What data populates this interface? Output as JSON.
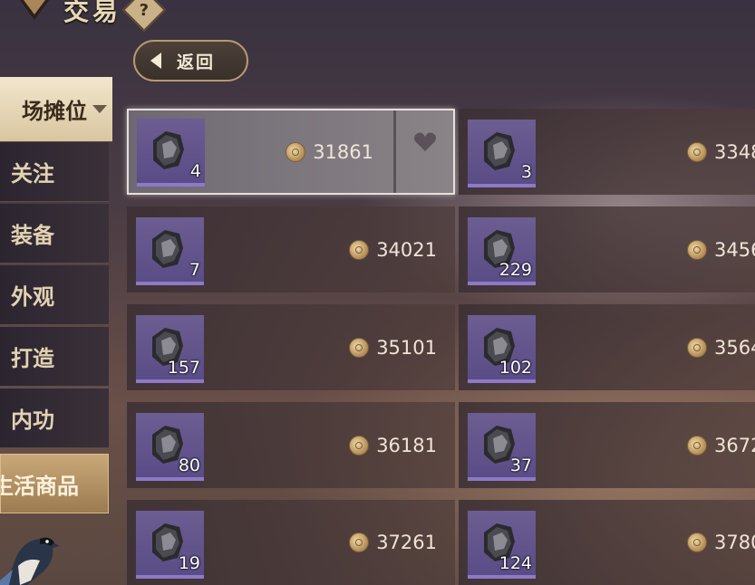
{
  "header": {
    "title": "交易",
    "help_icon": "question-diamond-icon"
  },
  "back_button": {
    "label": "返回",
    "icon": "caret-left-icon"
  },
  "sidebar": {
    "items": [
      {
        "label": "场摊位",
        "has_dropdown": true
      },
      {
        "label": "关注"
      },
      {
        "label": "装备"
      },
      {
        "label": "外观"
      },
      {
        "label": "打造"
      },
      {
        "label": "内功"
      },
      {
        "label": "生活商品"
      }
    ]
  },
  "listings": [
    {
      "qty": "4",
      "price": "31861",
      "favorite_icon": "heart-icon"
    },
    {
      "qty": "3",
      "price": "3348"
    },
    {
      "qty": "7",
      "price": "34021"
    },
    {
      "qty": "229",
      "price": "3456"
    },
    {
      "qty": "157",
      "price": "35101"
    },
    {
      "qty": "102",
      "price": "3564"
    },
    {
      "qty": "80",
      "price": "36181"
    },
    {
      "qty": "37",
      "price": "3672"
    },
    {
      "qty": "19",
      "price": "37261"
    },
    {
      "qty": "124",
      "price": "3780"
    }
  ],
  "colors": {
    "slot": "#5a4c86",
    "slot_accent": "#8d7ac6",
    "price_text": "#eee4d6",
    "gold_accent": "#b49a72"
  }
}
